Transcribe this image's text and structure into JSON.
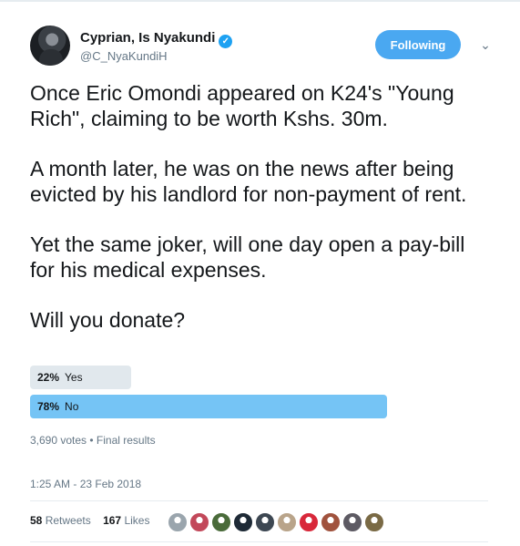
{
  "author": {
    "name": "Cyprian, Is Nyakundi",
    "handle": "@C_NyaKundiH",
    "verified_glyph": "✓",
    "follow_label": "Following",
    "menu_glyph": "⌄"
  },
  "tweet": {
    "paragraphs": [
      "Once Eric Omondi appeared on K24's \"Young Rich\", claiming to be worth Kshs. 30m.",
      "A month later, he was on the news after being evicted by his landlord for non-payment of rent.",
      "Yet the same joker, will one day open a pay-bill for his medical expenses.",
      "Will you donate?"
    ]
  },
  "poll": {
    "options": [
      {
        "percent_label": "22%",
        "label": "Yes",
        "percent": 22
      },
      {
        "percent_label": "78%",
        "label": "No",
        "percent": 78
      }
    ],
    "meta": "3,690 votes • Final results"
  },
  "timestamp": "1:25 AM - 23 Feb 2018",
  "stats": {
    "retweets_count": "58",
    "retweets_label": "Retweets",
    "likes_count": "167",
    "likes_label": "Likes"
  },
  "likers": [
    {
      "icon": "user-avatar-icon",
      "color": "#9aa5ad"
    },
    {
      "icon": "user-avatar-icon",
      "color": "#c2485a"
    },
    {
      "icon": "user-avatar-icon",
      "color": "#4a6b3a"
    },
    {
      "icon": "user-avatar-icon",
      "color": "#1e2a36"
    },
    {
      "icon": "user-avatar-icon",
      "color": "#3d4752"
    },
    {
      "icon": "user-avatar-icon",
      "color": "#b9a48a"
    },
    {
      "icon": "user-avatar-icon",
      "color": "#d8283a"
    },
    {
      "icon": "user-avatar-icon",
      "color": "#a0523d"
    },
    {
      "icon": "user-avatar-icon",
      "color": "#5d5a63"
    },
    {
      "icon": "user-avatar-icon",
      "color": "#7a6a45"
    }
  ]
}
